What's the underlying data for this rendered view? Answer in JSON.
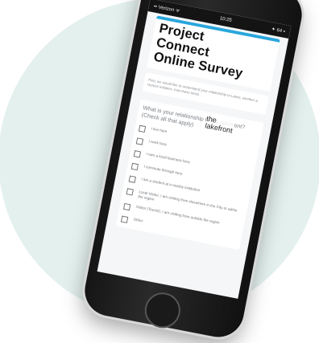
{
  "status_bar": {
    "carrier": "•• Verizon ᯤ",
    "time": "10:25",
    "battery": "✦ 64 ▪"
  },
  "survey": {
    "title": "Project\nConnect\nOnline Survey",
    "intro": "First, we would like to understand your relationship to Lakes, whether a Homes Initiative, how these times",
    "question": "What is your relationship to the lakefront? (Check all that apply)",
    "overlay_text": "the\nlakefront",
    "options": [
      "I live here",
      "I work here",
      "I own a local business here",
      "I commute through here",
      "I am a student at a nearby institution",
      "Local Visitor, I am visiting from elsewhere in the City or within the region",
      "Visitor (Tourist), I am visiting from outside the region",
      "Other:"
    ]
  },
  "colors": {
    "accent": "#29a6dc",
    "background_circle": "#e3f0ee"
  }
}
